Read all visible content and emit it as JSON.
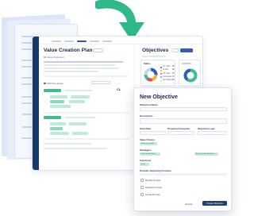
{
  "main_window": {
    "title": "Value Creation Plan",
    "subtitle": "Value Statement",
    "key_results_label": "Shift Key Areas",
    "objectives_title": "Objectives",
    "status_card_title": "Status",
    "status_legend": [
      "On Track",
      "At Risk",
      "Off Track",
      "Completed",
      "Not Started"
    ],
    "status_counts": [
      "08",
      "06",
      "05",
      "04",
      "08"
    ],
    "status_breakdown": [
      {
        "name": "On Track",
        "value": 8,
        "color": "#2f5db8"
      },
      {
        "name": "At Risk",
        "value": 6,
        "color": "#f2b233"
      },
      {
        "name": "Off Track",
        "value": 5,
        "color": "#d9534f"
      },
      {
        "name": "Completed",
        "value": 4,
        "color": "#3dbd90"
      },
      {
        "name": "Not Started",
        "value": 8,
        "color": "#c9d3e3"
      }
    ],
    "progress_card_title": "Progress",
    "progress_breakdown": [
      {
        "name": "Done",
        "value": 60,
        "color": "#3dbd90"
      },
      {
        "name": "Remaining",
        "value": 40,
        "color": "#2f5db8"
      }
    ],
    "company_badge": "CL"
  },
  "dialog": {
    "title": "New Objective",
    "objective_name_label": "Objective Name",
    "description_label": "Description",
    "start_date_label": "Start Date",
    "projected_complete_label": "Projected Complete",
    "objective_lead_label": "Objective Lead",
    "value_drivers_label": "Value Drivers",
    "value_driver_chip": "Revenue Growth",
    "strategies_label": "Strategies",
    "strategy_chips": [
      "Grow Market Share",
      "Raising Quota Guidance"
    ],
    "functions_label": "Functions",
    "function_chip": "Sales",
    "reporting_label": "Periodic Reporting Prompts",
    "prompts": [
      "Monthly Prompts",
      "Quarterly Prompts",
      "Annual Prompts"
    ],
    "cancel_label": "Cancel",
    "create_label": "Create Objective"
  },
  "colors": {
    "navy": "#173a6b",
    "accent_blue": "#2f5db8",
    "accent_green": "#3dbd90",
    "arrow_green": "#2fb889"
  }
}
